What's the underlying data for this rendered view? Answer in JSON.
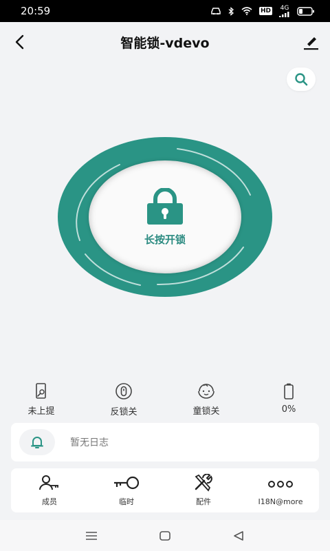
{
  "status_bar": {
    "time": "20:59",
    "hd_badge": "HD",
    "network": "4G"
  },
  "header": {
    "title": "智能锁-vdevo"
  },
  "lock": {
    "label": "长按开锁",
    "accent_color": "#2a9485"
  },
  "status_items": [
    {
      "label": "未上提",
      "icon": "door-handle-icon"
    },
    {
      "label": "反锁关",
      "icon": "deadbolt-icon"
    },
    {
      "label": "童锁关",
      "icon": "child-face-icon"
    },
    {
      "label": "0%",
      "icon": "battery-icon"
    }
  ],
  "log": {
    "empty_text": "暂无日志",
    "icon": "bell-icon"
  },
  "tools": [
    {
      "label": "成员",
      "icon": "member-icon"
    },
    {
      "label": "临时",
      "icon": "temporary-key-icon"
    },
    {
      "label": "配件",
      "icon": "accessories-tools-icon"
    },
    {
      "label": "I18N@more",
      "icon": "more-dots-icon"
    }
  ]
}
